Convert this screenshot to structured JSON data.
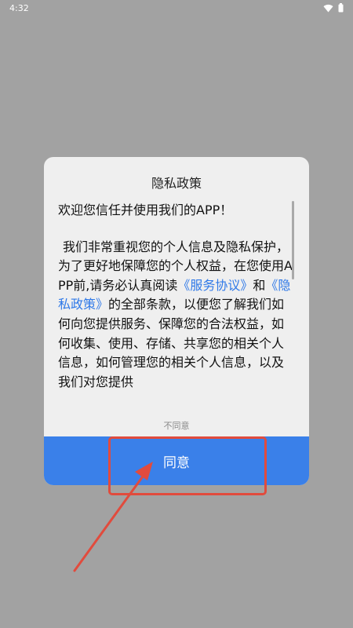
{
  "status_bar": {
    "time": "4:32",
    "icons": [
      "wifi-icon",
      "battery-icon"
    ]
  },
  "dialog": {
    "title": "隐私政策",
    "greeting": "欢迎您信任并使用我们的APP！",
    "body_part1": "我们非常重视您的个人信息及隐私保护，为了更好地保障您的个人权益，在您使用APP前,请务必认真阅读",
    "link_service": "《服务协议》",
    "conjunction": "和",
    "link_privacy": "《隐私政策》",
    "body_part2": "的全部条款，以便您了解我们如何向您提供服务、保障您的合法权益，如何收集、使用、存储、共享您的相关个人信息，如何管理您的相关个人信息，以及我们对您提供",
    "disagree_label": "不同意",
    "agree_label": "同意"
  },
  "colors": {
    "overlay": "#a2a2a2",
    "dialog_bg": "#efefef",
    "accent": "#3a80e9",
    "link": "#2f79e8",
    "annotation": "#e14b3d"
  }
}
